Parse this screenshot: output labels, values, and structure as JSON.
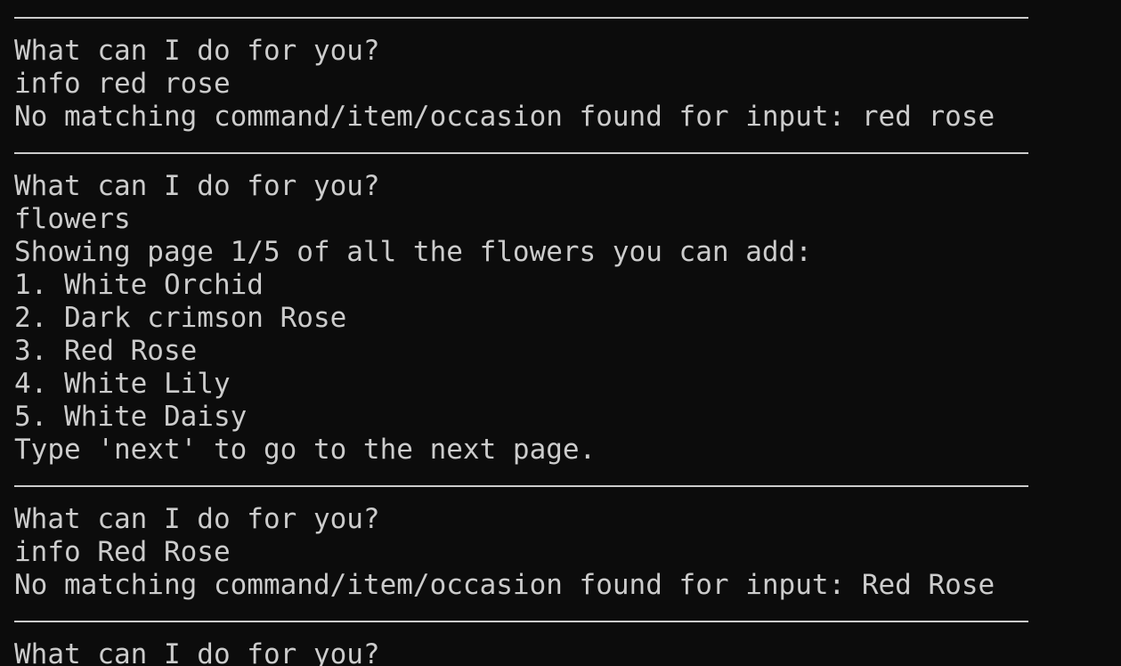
{
  "theme": {
    "background": "#0c0c0c",
    "foreground": "#cccccc"
  },
  "blocks": [
    {
      "lines": [
        "What can I do for you?",
        "info red rose",
        "No matching command/item/occasion found for input: red rose"
      ]
    },
    {
      "lines": [
        "What can I do for you?",
        "flowers",
        "Showing page 1/5 of all the flowers you can add:",
        "1. White Orchid",
        "2. Dark crimson Rose",
        "3. Red Rose",
        "4. White Lily",
        "5. White Daisy",
        "Type 'next' to go to the next page."
      ]
    },
    {
      "lines": [
        "What can I do for you?",
        "info Red Rose",
        "No matching command/item/occasion found for input: Red Rose"
      ]
    },
    {
      "lines": [
        "What can I do for you?"
      ]
    }
  ]
}
